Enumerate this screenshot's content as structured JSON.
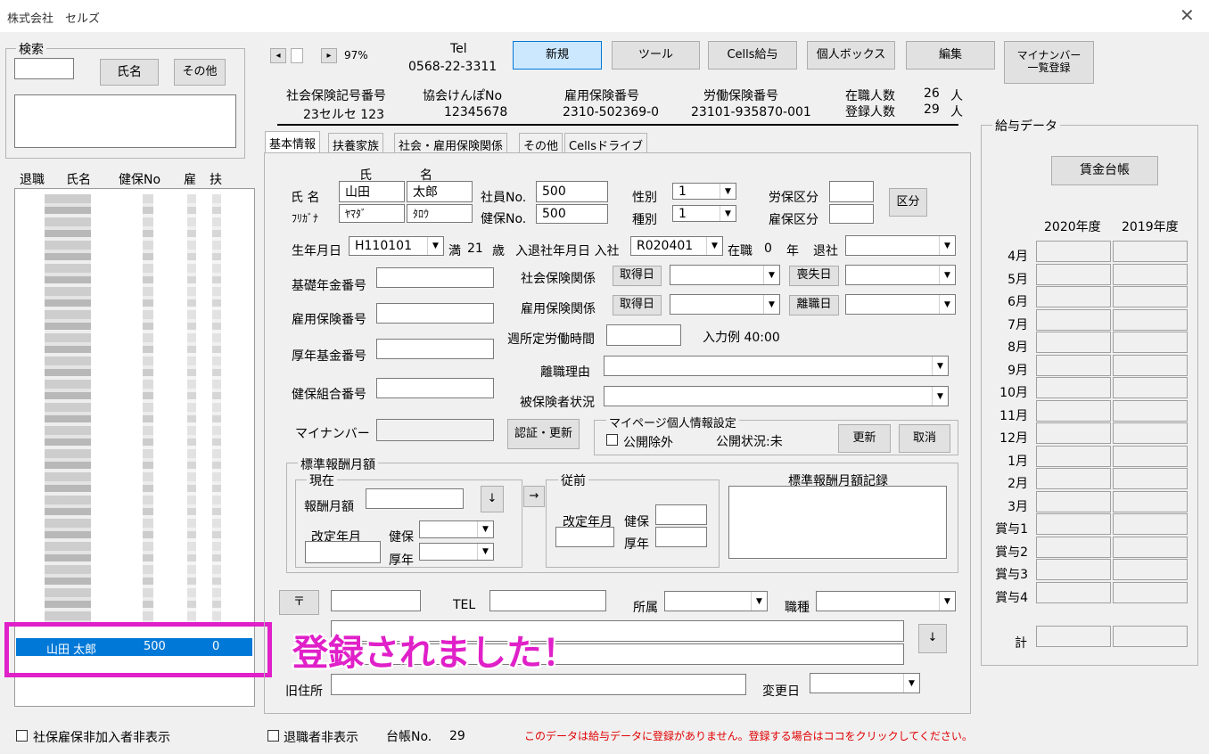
{
  "window": {
    "title": "株式会社　セルズ"
  },
  "search": {
    "frame_label": "検索",
    "name_button": "氏名",
    "other_button": "その他"
  },
  "list": {
    "headers": [
      "退職",
      "氏名",
      "健保No",
      "雇",
      "扶"
    ],
    "selected_row": {
      "name": "山田 太郎",
      "kenpo_no": "500",
      "value": "0"
    }
  },
  "overlay": {
    "message": "登録されました！",
    "color": "#e020c8"
  },
  "nav": {
    "prev": "◂",
    "next": "▸",
    "zoom": "97%"
  },
  "company": {
    "tel_label": "Tel",
    "tel": "0568-22-3311"
  },
  "toolbar": {
    "new": "新規",
    "tool": "ツール",
    "cells_salary": "Cells給与",
    "personal_box": "個人ボックス",
    "edit": "編集",
    "mynumber_list": "マイナンバー\n一覧登録"
  },
  "insurance": {
    "social_label": "社会保険記号番号",
    "social_value": "23セルセ 123",
    "kyokai_label": "協会けんぽNo",
    "kyokai_value": "12345678",
    "koyo_label": "雇用保険番号",
    "koyo_value": "2310-502369-0",
    "rodo_label": "労働保険番号",
    "rodo_value": "23101-935870-001",
    "zaishoku_label": "在職人数",
    "zaishoku_value": "26",
    "zaishoku_unit": "人",
    "toroku_label": "登録人数",
    "toroku_value": "29",
    "toroku_unit": "人"
  },
  "tabs": [
    "基本情報",
    "扶養家族",
    "社会・雇用保険関係",
    "その他",
    "Cellsドライブ"
  ],
  "basic": {
    "shi_head": "氏",
    "mei_head": "名",
    "name_label": "氏 名",
    "furigana_label": "ﾌﾘｶﾞﾅ",
    "last_name": "山田",
    "first_name": "太郎",
    "last_kana": "ﾔﾏﾀﾞ",
    "first_kana": "ﾀﾛｳ",
    "emp_no_label": "社員No.",
    "emp_no": "500",
    "kenpo_no_label": "健保No.",
    "kenpo_no": "500",
    "sex_label": "性別",
    "sex": "1",
    "kind_label": "種別",
    "kind": "1",
    "rouho_label": "労保区分",
    "koyoho_label": "雇保区分",
    "kubun_button": "区分",
    "birth_label": "生年月日",
    "birth": "H110101",
    "age_prefix": "満",
    "age": "21",
    "age_unit": "歳",
    "join_label": "入退社年月日 入社",
    "join": "R020401",
    "tenure_label": "在職",
    "tenure": "0",
    "tenure_unit": "年",
    "leave_label": "退社",
    "kiso_label": "基礎年金番号",
    "koyo_no_label": "雇用保険番号",
    "kosei_label": "厚年基金番号",
    "kumiai_label": "健保組合番号",
    "mynumber_label": "マイナンバー",
    "shaho_label": "社会保険関係",
    "koyo_kankei_label": "雇用保険関係",
    "shutoku": "取得日",
    "soshitsu": "喪失日",
    "rishoku": "離職日",
    "hours_label": "週所定労働時間",
    "hours_example": "入力例  40:00",
    "reason_label": "離職理由",
    "insured_label": "被保険者状況",
    "auth_button": "認証・更新",
    "mypage_title": "マイページ個人情報設定",
    "kokai_label": "公開除外",
    "kokai_status": "公開状況:未",
    "update_button": "更新",
    "cancel_button": "取消"
  },
  "hoshu": {
    "frame": "標準報酬月額",
    "current": "現在",
    "monthly_label": "報酬月額",
    "down": "↓",
    "right": "→",
    "kaitei_label": "改定年月",
    "kenpo": "健保",
    "kosei": "厚年",
    "previous": "従前",
    "record_title": "標準報酬月額記録"
  },
  "address": {
    "postal_button": "〒",
    "tel_label": "TEL",
    "dept_label": "所属",
    "job_label": "職種",
    "old_address_label": "旧住所",
    "change_date_label": "変更日",
    "down": "↓"
  },
  "salary": {
    "frame": "給与データ",
    "ledger_button": "賃金台帳",
    "years": [
      "2020年度",
      "2019年度"
    ],
    "months": [
      "4月",
      "5月",
      "6月",
      "7月",
      "8月",
      "9月",
      "10月",
      "11月",
      "12月",
      "1月",
      "2月",
      "3月",
      "賞与1",
      "賞与2",
      "賞与3",
      "賞与4"
    ],
    "total_label": "計"
  },
  "footer": {
    "hide_unenrolled": "社保雇保非加入者非表示",
    "hide_retired": "退職者非表示",
    "ledger_no_label": "台帳No.",
    "ledger_no": "29",
    "warning": "このデータは給与データに登録がありません。登録する場合はココをクリックしてください。"
  }
}
